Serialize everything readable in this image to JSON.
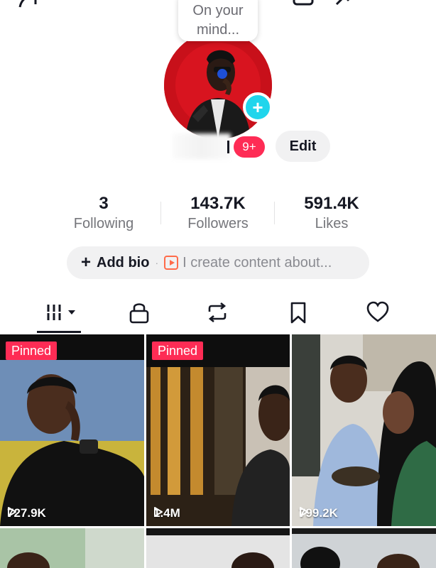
{
  "status_bubble": {
    "line1": "On your",
    "line2": "mind..."
  },
  "profile": {
    "notification_badge": "9+",
    "edit_label": "Edit"
  },
  "stats": [
    {
      "value": "3",
      "label": "Following"
    },
    {
      "value": "143.7K",
      "label": "Followers"
    },
    {
      "value": "591.4K",
      "label": "Likes"
    }
  ],
  "bio": {
    "plus": "+",
    "add_label": "Add bio",
    "separator": "·",
    "hint": "I create content about..."
  },
  "tabs": [
    {
      "icon": "videos-grid-icon",
      "active": true
    },
    {
      "icon": "lock-icon",
      "active": false
    },
    {
      "icon": "repost-icon",
      "active": false
    },
    {
      "icon": "bookmark-icon",
      "active": false
    },
    {
      "icon": "heart-icon",
      "active": false
    }
  ],
  "videos": [
    {
      "pinned_label": "Pinned",
      "views": "727.9K"
    },
    {
      "pinned_label": "Pinned",
      "views": "1.4M"
    },
    {
      "pinned_label": "",
      "views": "799.2K"
    }
  ],
  "colors": {
    "accent": "#fe2c55",
    "add_button": "#20d5ec",
    "text_primary": "#161823",
    "text_secondary": "#75767b"
  }
}
